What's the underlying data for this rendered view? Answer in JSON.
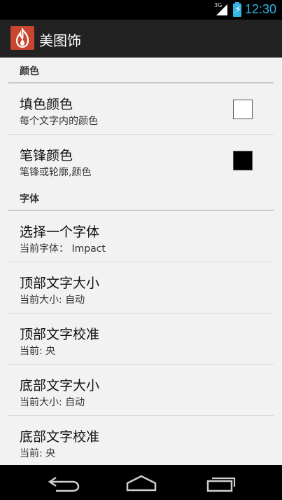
{
  "status_bar": {
    "network": "3G",
    "time": "12:30"
  },
  "action_bar": {
    "app_title": "美图饰"
  },
  "sections": [
    {
      "title": "颜色",
      "items": [
        {
          "title": "填色颜色",
          "summary": "每个文字内的颜色",
          "swatch_color": "#ffffff"
        },
        {
          "title": "笔锋颜色",
          "summary": "笔锋或轮廓,颜色",
          "swatch_color": "#000000"
        }
      ]
    },
    {
      "title": "字体",
      "items": [
        {
          "title": "选择一个字体",
          "summary": "当前字体： Impact"
        },
        {
          "title": "顶部文字大小",
          "summary": "当前大小: 自动"
        },
        {
          "title": "顶部文字校准",
          "summary": "当前: 央"
        },
        {
          "title": "底部文字大小",
          "summary": "当前大小: 自动"
        },
        {
          "title": "底部文字校准",
          "summary": "当前: 央"
        }
      ]
    }
  ],
  "nav_bar": {
    "buttons": [
      "back-icon",
      "home-icon",
      "recents-icon"
    ]
  }
}
